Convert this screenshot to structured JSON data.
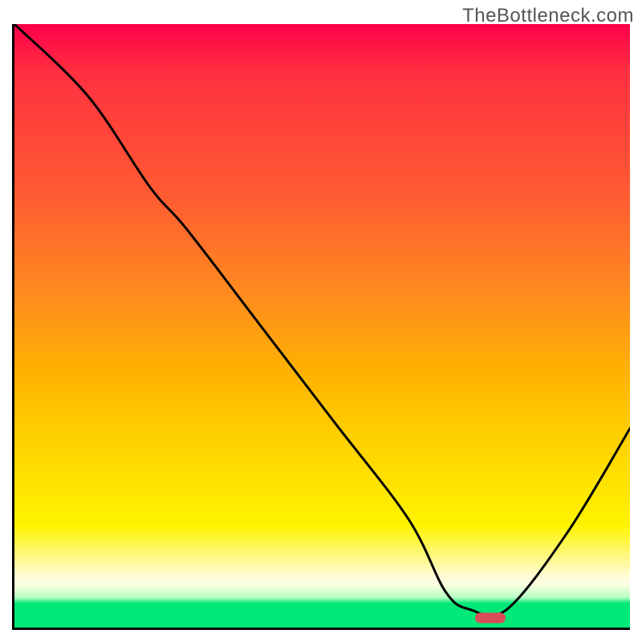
{
  "watermark": "TheBottleneck.com",
  "chart_data": {
    "type": "line",
    "title": "",
    "xlabel": "",
    "ylabel": "",
    "xlim": [
      0,
      100
    ],
    "ylim": [
      0,
      100
    ],
    "grid": false,
    "background_gradient": {
      "direction": "vertical",
      "stops": [
        {
          "pos": 0.0,
          "color": "#ff004a"
        },
        {
          "pos": 0.28,
          "color": "#ff5a32"
        },
        {
          "pos": 0.58,
          "color": "#ffb300"
        },
        {
          "pos": 0.83,
          "color": "#fff300"
        },
        {
          "pos": 0.93,
          "color": "#f8ffe0"
        },
        {
          "pos": 0.96,
          "color": "#00e878"
        },
        {
          "pos": 1.0,
          "color": "#00e878"
        }
      ]
    },
    "series": [
      {
        "name": "bottleneck-curve",
        "color": "#000000",
        "x": [
          0,
          12,
          22,
          28,
          40,
          52,
          64,
          70,
          74,
          80,
          90,
          100
        ],
        "y": [
          100,
          88,
          73,
          66,
          50,
          34,
          18,
          6,
          3,
          3,
          16,
          33
        ]
      }
    ],
    "optimum_marker": {
      "x": 77,
      "y": 2,
      "color": "#d94d57",
      "shape": "pill"
    }
  }
}
